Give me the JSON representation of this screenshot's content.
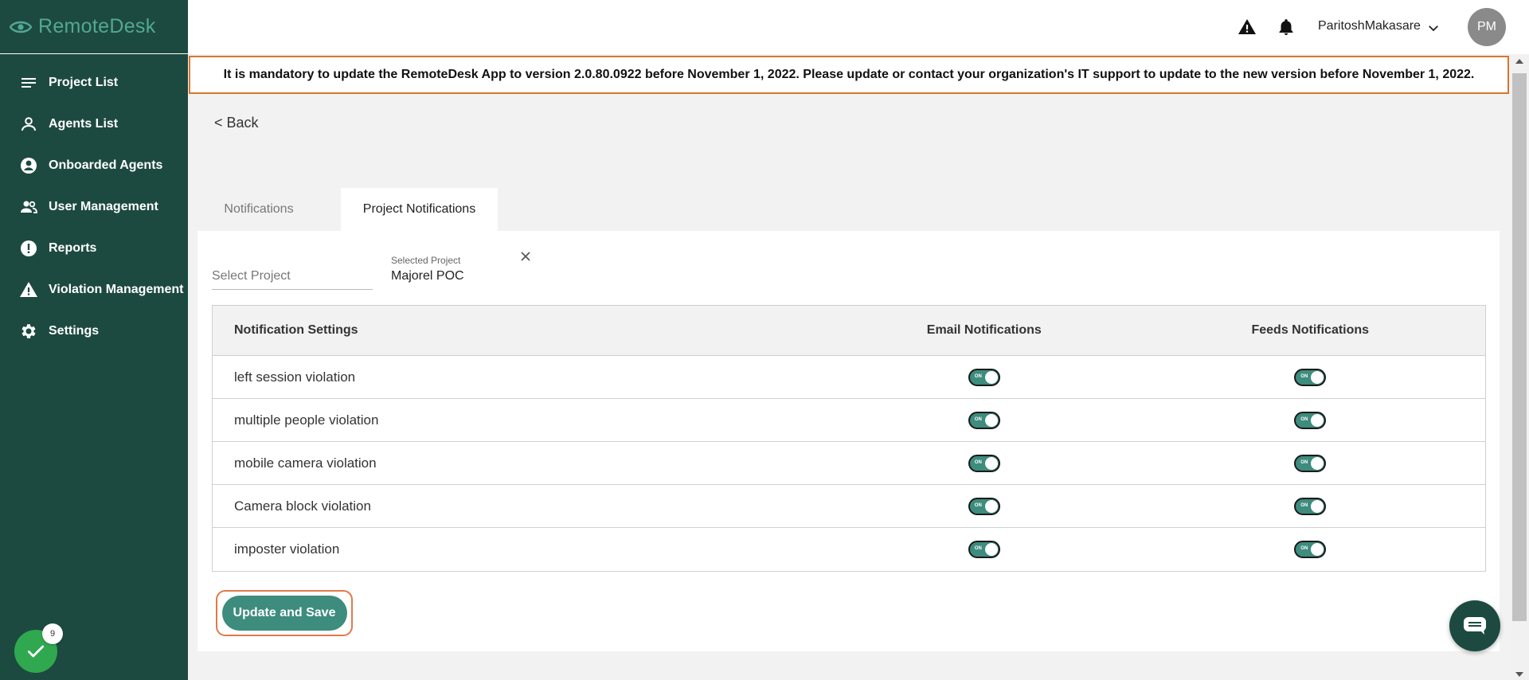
{
  "brand": {
    "name": "RemoteDesk"
  },
  "sidebar": {
    "items": [
      {
        "label": "Project List",
        "icon": "list-icon"
      },
      {
        "label": "Agents List",
        "icon": "person-icon"
      },
      {
        "label": "Onboarded Agents",
        "icon": "account-circle-icon"
      },
      {
        "label": "User Management",
        "icon": "people-icon"
      },
      {
        "label": "Reports",
        "icon": "alert-circle-icon"
      },
      {
        "label": "Violation Management",
        "icon": "warning-icon"
      },
      {
        "label": "Settings",
        "icon": "gear-icon"
      }
    ],
    "badge_count": "9"
  },
  "header": {
    "user_name": "ParitoshMakasare",
    "avatar_initials": "PM"
  },
  "banner": {
    "text": "It is mandatory to update the RemoteDesk App to version 2.0.80.0922 before November 1, 2022. Please update or contact your organization's IT support to update to the new version before November 1, 2022."
  },
  "back_label": "< Back",
  "tabs": [
    {
      "label": "Notifications",
      "active": false
    },
    {
      "label": "Project Notifications",
      "active": true
    }
  ],
  "project_select": {
    "placeholder": "Select Project",
    "selected_label": "Selected Project",
    "selected_value": "Majorel POC"
  },
  "table": {
    "headers": [
      "Notification Settings",
      "Email Notifications",
      "Feeds Notifications"
    ],
    "toggle_label": "ON",
    "rows": [
      {
        "name": "left session violation",
        "email": true,
        "feeds": true
      },
      {
        "name": "multiple people violation",
        "email": true,
        "feeds": true
      },
      {
        "name": "mobile camera violation",
        "email": true,
        "feeds": true
      },
      {
        "name": "Camera block violation",
        "email": true,
        "feeds": true
      },
      {
        "name": "imposter violation",
        "email": true,
        "feeds": true
      }
    ]
  },
  "save_label": "Update and Save",
  "colors": {
    "sidebar": "#1d4a40",
    "accent": "#3d8c7e",
    "banner_border": "#d9752f",
    "highlight": "#e07a48",
    "badge": "#2fa84f"
  }
}
